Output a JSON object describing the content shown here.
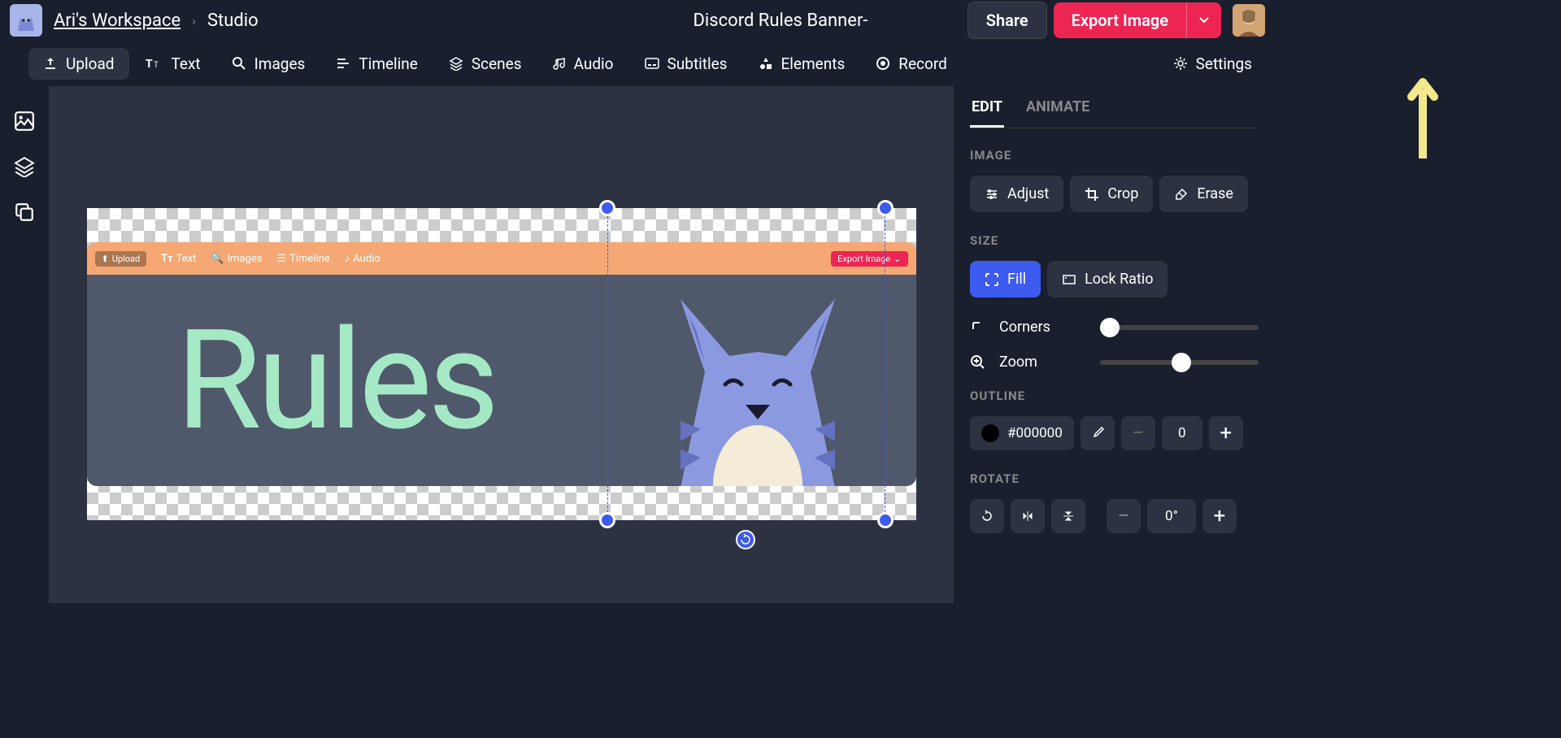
{
  "header": {
    "workspace": "Ari's Workspace",
    "studio": "Studio",
    "title": "Discord Rules Banner-",
    "share": "Share",
    "export": "Export Image"
  },
  "toolbar": [
    "Upload",
    "Text",
    "Images",
    "Timeline",
    "Scenes",
    "Audio",
    "Subtitles",
    "Elements",
    "Record",
    "Settings"
  ],
  "banner": {
    "upload": "Upload",
    "text": "Text",
    "images": "Images",
    "timeline": "Timeline",
    "audio": "Audio",
    "export": "Export Image",
    "rules": "Rules"
  },
  "panel": {
    "tabs": [
      "EDIT",
      "ANIMATE"
    ],
    "image": {
      "label": "IMAGE",
      "adjust": "Adjust",
      "crop": "Crop",
      "erase": "Erase"
    },
    "size": {
      "label": "SIZE",
      "fill": "Fill",
      "lock": "Lock Ratio",
      "corners": "Corners",
      "zoom": "Zoom"
    },
    "outline": {
      "label": "OUTLINE",
      "color": "#000000",
      "value": "0"
    },
    "rotate": {
      "label": "ROTATE",
      "value": "0°"
    }
  }
}
